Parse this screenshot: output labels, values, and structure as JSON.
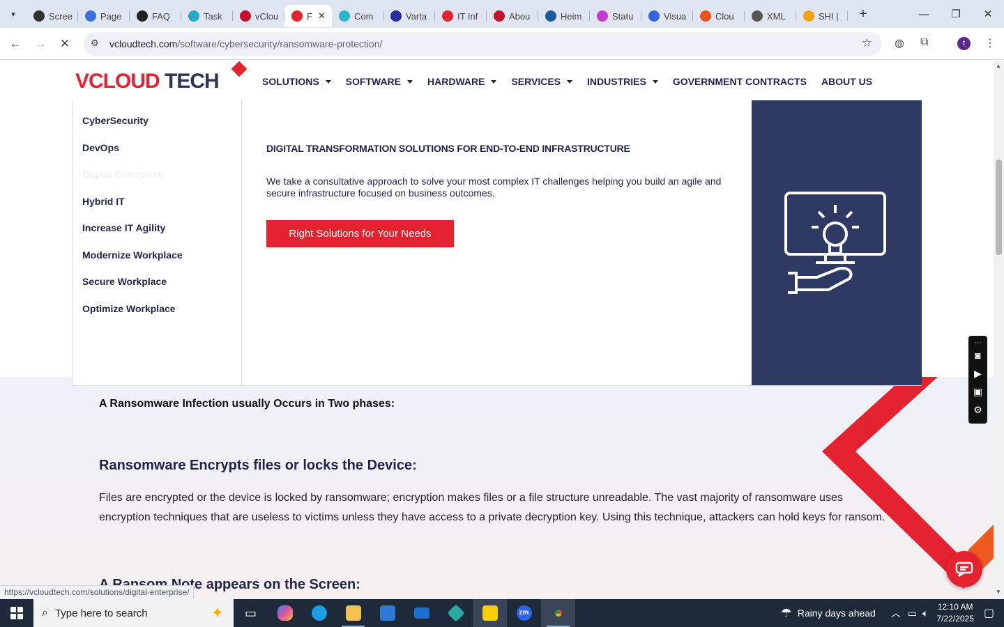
{
  "browser": {
    "tabs": [
      {
        "label": "Scree",
        "color": "#333333"
      },
      {
        "label": "Page",
        "color": "#3b6fd8"
      },
      {
        "label": "FAQ",
        "color": "#222222"
      },
      {
        "label": "Task",
        "color": "#2aa8c9"
      },
      {
        "label": "vClou",
        "color": "#c0102a"
      },
      {
        "label": "F",
        "color": "#e52330",
        "active": true
      },
      {
        "label": "Com",
        "color": "#29b6c9"
      },
      {
        "label": "Varta",
        "color": "#2a2f9c"
      },
      {
        "label": "IT Inf",
        "color": "#e52330"
      },
      {
        "label": "Abou",
        "color": "#c0102a"
      },
      {
        "label": "Heim",
        "color": "#1a5aa0"
      },
      {
        "label": "Statu",
        "color": "#c43ad0"
      },
      {
        "label": "Visua",
        "color": "#3366dd"
      },
      {
        "label": "Clou",
        "color": "#e85020"
      },
      {
        "label": "XML",
        "color": "#555555"
      },
      {
        "label": "SHI |",
        "color": "#f3a10f"
      }
    ],
    "new_tab": "+",
    "url_host": "vcloudtech.com",
    "url_path": "/software/cybersecurity/ransomware-protection/",
    "profile_initial": "t"
  },
  "site": {
    "logo_red": "VCLOUD",
    "logo_dark": "TECH",
    "nav": [
      {
        "label": "SOLUTIONS",
        "dropdown": true
      },
      {
        "label": "SOFTWARE",
        "dropdown": true
      },
      {
        "label": "HARDWARE",
        "dropdown": true
      },
      {
        "label": "SERVICES",
        "dropdown": true
      },
      {
        "label": "INDUSTRIES",
        "dropdown": true
      },
      {
        "label": "GOVERNMENT CONTRACTS",
        "dropdown": false
      },
      {
        "label": "ABOUT US",
        "dropdown": false
      }
    ],
    "brand_red": "#e52330",
    "brand_navy": "#2f3a64"
  },
  "mega_menu": {
    "items": [
      "CyberSecurity",
      "DevOps",
      "Digital Enterprise",
      "Hybrid IT",
      "Increase IT Agility",
      "Modernize Workplace",
      "Secure Workplace",
      "Optimize Workplace"
    ],
    "hovered_index": 2,
    "heading": "DIGITAL TRANSFORMATION SOLUTIONS FOR END-TO-END INFRASTRUCTURE",
    "description": "We take a consultative approach to solve your most complex IT challenges helping you build an agile and secure infrastructure focused on business outcomes.",
    "cta_label": "Right Solutions for Your Needs",
    "panel_icon": "monitor-lightbulb-hand-icon"
  },
  "article": {
    "phases_heading": "A Ransomware Infection usually Occurs in Two phases:",
    "encrypt_heading": "Ransomware Encrypts files or locks the Device:",
    "encrypt_body": "Files are encrypted or the device is locked by ransomware; encryption makes files or a file structure unreadable. The vast majority of ransomware uses encryption techniques that are useless to victims unless they have access to a private decryption key. Using this technique, attackers can hold keys for ransom.",
    "note_heading": "A Ransom Note appears on the Screen:"
  },
  "status_bar": {
    "hover_url": "https://vcloudtech.com/solutions/digital-enterprise/"
  },
  "taskbar": {
    "search_placeholder": "Type here to search",
    "weather": "Rainy days ahead",
    "time": "12:10 AM",
    "date": "7/22/2025"
  }
}
